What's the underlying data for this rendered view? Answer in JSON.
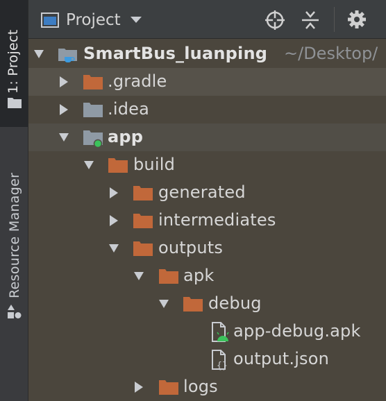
{
  "side_strip": {
    "project_tab_label": "1: Project",
    "resource_tab_label": "Resource Manager"
  },
  "header": {
    "view_title": "Project",
    "icons": [
      "project-window-icon",
      "chevron-down-icon",
      "locate-target-icon",
      "collapse-all-icon",
      "gear-icon"
    ]
  },
  "tree": {
    "root": {
      "label": "SmartBus_luanping",
      "path": "~/Desktop/"
    },
    "gradle": ".gradle",
    "idea": ".idea",
    "app": "app",
    "build": "build",
    "generated": "generated",
    "intermediates": "intermediates",
    "outputs": "outputs",
    "apk": "apk",
    "debug": "debug",
    "apk_file": "app-debug.apk",
    "json_file": "output.json",
    "logs": "logs"
  },
  "colors": {
    "folder_orange": "#c1683a",
    "folder_gray": "#8f9aa5",
    "module_dot": "#3bc25b",
    "background": "#4b463d",
    "header": "#3c3f41"
  }
}
